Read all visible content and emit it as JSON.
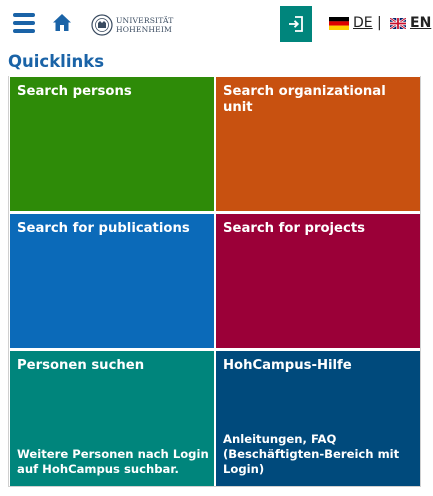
{
  "header": {
    "logo_lines": [
      "UNIVERSITÄT",
      "HOHENHEIM"
    ],
    "languages": [
      {
        "code": "DE",
        "flag": "germany-flag-icon"
      },
      {
        "code": "EN",
        "flag": "uk-flag-icon"
      }
    ],
    "separator": "|",
    "colors": {
      "primary": "#1a63a7",
      "login": "#00857c"
    }
  },
  "quicklinks": {
    "title": "Quicklinks",
    "tiles": [
      {
        "title": "Search persons",
        "subtitle": "",
        "color": "#2e8b08"
      },
      {
        "title": "Search organizational unit",
        "subtitle": "",
        "color": "#c85110"
      },
      {
        "title": "Search for publications",
        "subtitle": "",
        "color": "#0b6ab9"
      },
      {
        "title": "Search for projects",
        "subtitle": "",
        "color": "#9b0038"
      },
      {
        "title": "Personen suchen",
        "subtitle": "Weitere Personen nach Login\nauf HohCampus suchbar.",
        "color": "#00857c"
      },
      {
        "title": "HohCampus-Hilfe",
        "subtitle": "Anleitungen, FAQ\n(Beschäftigten-Bereich mit\nLogin)",
        "color": "#004a7c"
      }
    ]
  }
}
